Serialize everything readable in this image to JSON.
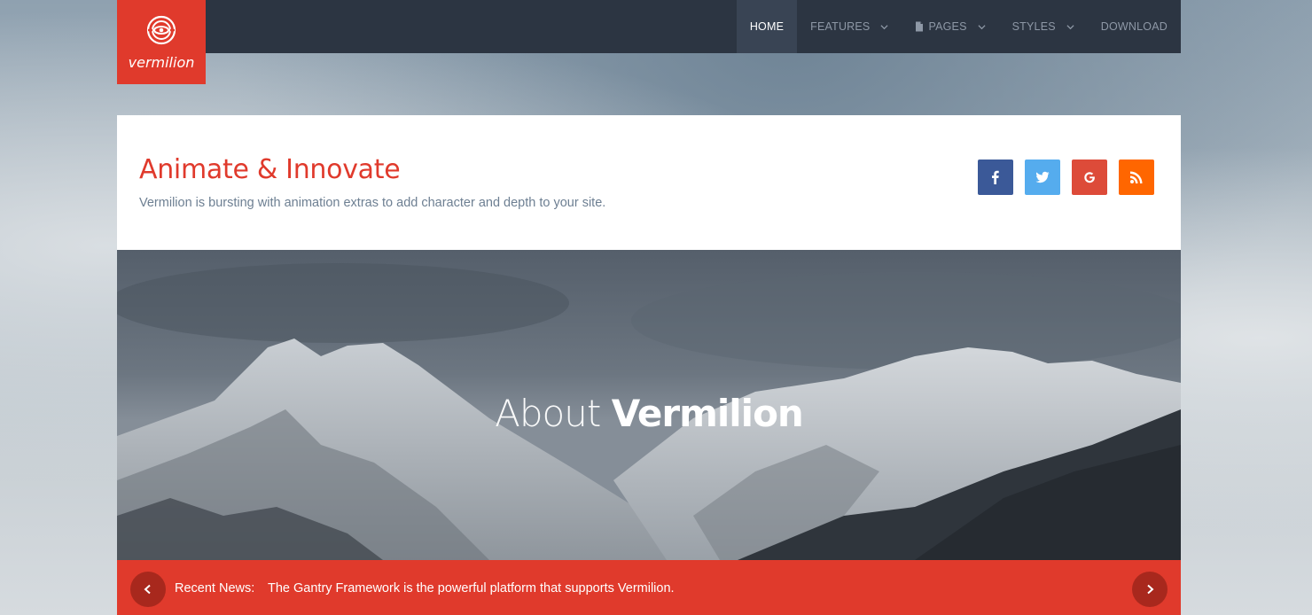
{
  "brand": {
    "name": "vermilion",
    "color": "#e03a2c"
  },
  "nav": {
    "items": [
      {
        "label": "HOME",
        "active": true
      },
      {
        "label": "FEATURES",
        "dropdown": true
      },
      {
        "label": "PAGES",
        "dropdown": true,
        "icon": "document-icon"
      },
      {
        "label": "STYLES",
        "dropdown": true
      },
      {
        "label": "DOWNLOAD"
      }
    ]
  },
  "header": {
    "title": "Animate & Innovate",
    "subtitle": "Vermilion is bursting with animation extras to add character and depth to your site."
  },
  "social": [
    {
      "icon": "facebook-icon",
      "color": "#3b5998"
    },
    {
      "icon": "twitter-icon",
      "color": "#55acee"
    },
    {
      "icon": "google-icon",
      "color": "#dd4b39"
    },
    {
      "icon": "rss-icon",
      "color": "#ff6600"
    }
  ],
  "hero": {
    "title_light": "About",
    "title_bold": "Vermilion"
  },
  "news": {
    "label": "Recent News:",
    "text": "The Gantry Framework is the powerful platform that supports Vermilion."
  }
}
